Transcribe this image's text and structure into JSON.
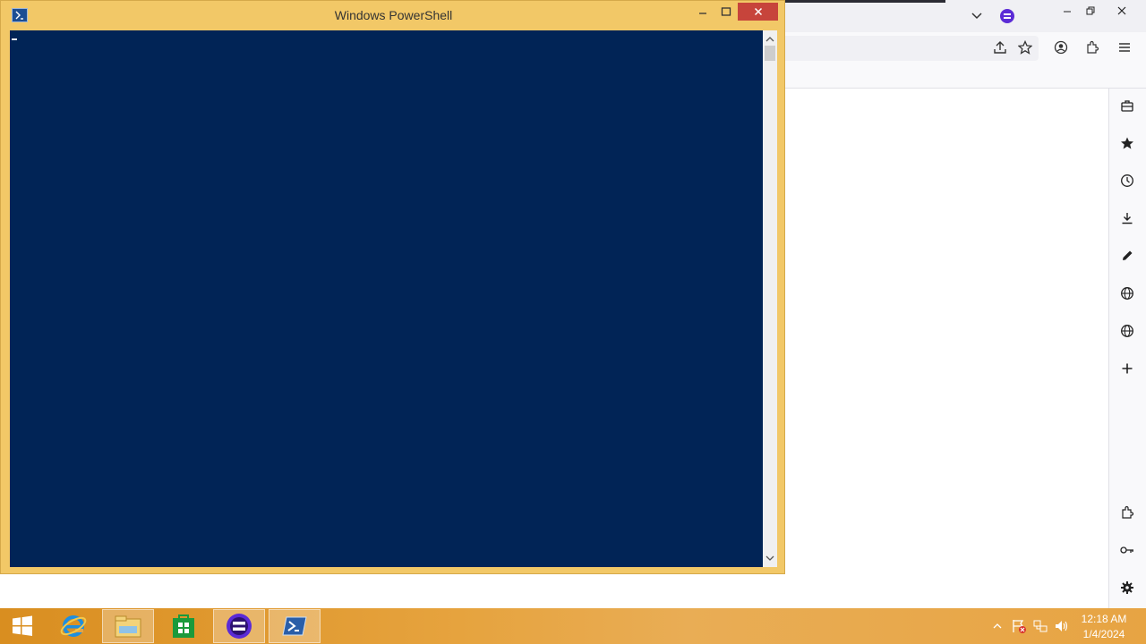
{
  "powershell": {
    "title": "Windows PowerShell",
    "colors": {
      "titlebar": "#f2c867",
      "console_bg": "#012456",
      "close_button": "#c7443b"
    },
    "icon": "powershell-icon"
  },
  "browser": {
    "toolbar_icons": [
      "share-icon",
      "bookmark-star-icon",
      "account-icon",
      "extensions-icon",
      "menu-icon"
    ],
    "sidebar_icons": [
      "briefcase-icon",
      "star-icon",
      "history-clock-icon",
      "download-icon",
      "pen-icon",
      "globe-icon",
      "globe-icon",
      "add-icon",
      "extensions-icon",
      "key-icon",
      "gear-icon"
    ]
  },
  "taskbar": {
    "items": [
      {
        "name": "start-button",
        "icon": "windows-logo-icon"
      },
      {
        "name": "internet-explorer",
        "icon": "ie-icon"
      },
      {
        "name": "file-explorer",
        "icon": "folder-icon"
      },
      {
        "name": "store",
        "icon": "store-icon"
      },
      {
        "name": "browser-app",
        "icon": "browser-app-icon"
      },
      {
        "name": "powershell",
        "icon": "powershell-icon"
      }
    ],
    "clock": {
      "time": "12:18 AM",
      "date": "1/4/2024"
    }
  }
}
